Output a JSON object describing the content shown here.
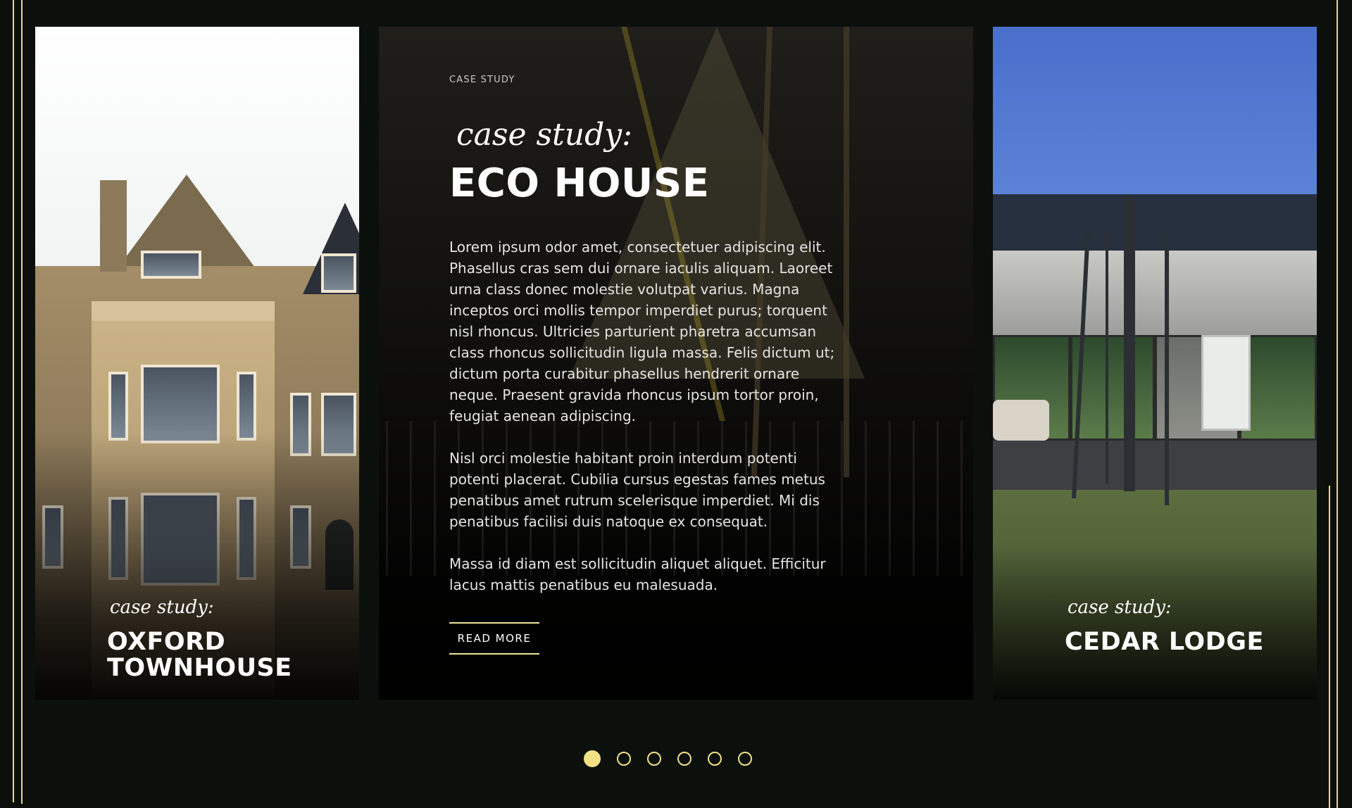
{
  "carousel": {
    "left_card": {
      "eyebrow_script": "case study:",
      "title_line1": "OXFORD",
      "title_line2": "TOWNHOUSE"
    },
    "center_card": {
      "eyebrow": "CASE STUDY",
      "script": "case study:",
      "title": "ECO HOUSE",
      "paragraphs": [
        "Lorem ipsum odor amet, consectetuer adipiscing elit. Phasellus cras sem dui ornare iaculis aliquam. Laoreet urna class donec molestie volutpat varius. Magna inceptos orci mollis tempor imperdiet purus; torquent nisl rhoncus. Ultricies parturient pharetra accumsan class rhoncus sollicitudin ligula massa. Felis dictum ut; dictum porta curabitur phasellus hendrerit ornare neque. Praesent gravida rhoncus ipsum tortor proin, feugiat aenean adipiscing.",
        "Nisl orci molestie habitant proin interdum potenti potenti placerat. Cubilia cursus egestas fames metus penatibus amet rutrum scelerisque imperdiet. Mi dis penatibus facilisi duis natoque ex consequat.",
        "Massa id diam est sollicitudin aliquet aliquet. Efficitur lacus mattis penatibus eu malesuada."
      ],
      "button_label": "READ MORE"
    },
    "right_card": {
      "eyebrow_script": "case study:",
      "title": "CEDAR LODGE"
    },
    "pagination": {
      "total": 6,
      "active_index": 0
    }
  },
  "colors": {
    "accent": "#f2e283",
    "background": "#0c100d",
    "card_dark": "#151515"
  }
}
